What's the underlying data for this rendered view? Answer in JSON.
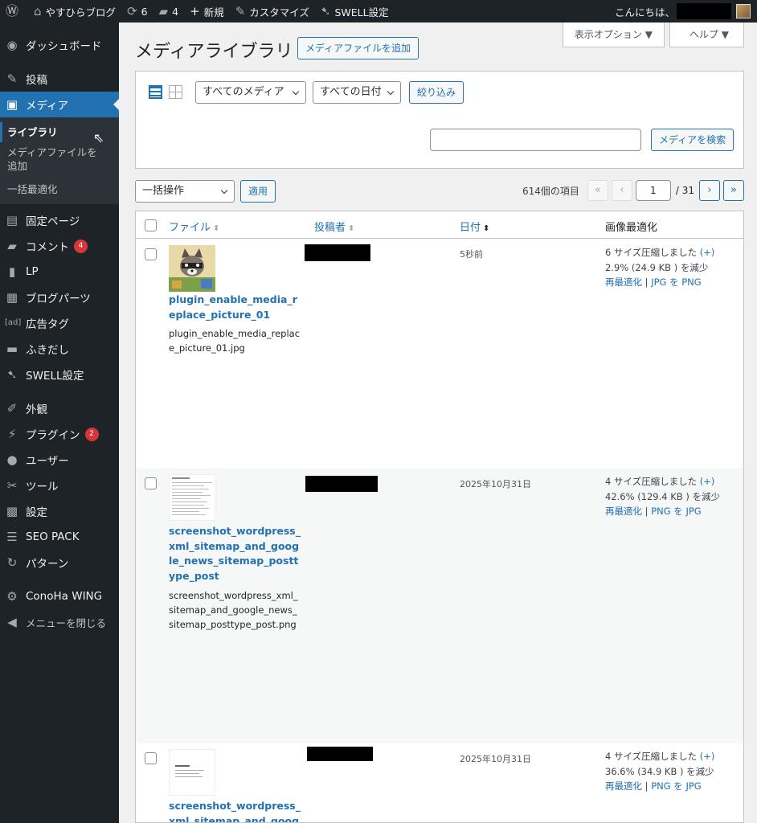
{
  "adminbar": {
    "site_name": "やすひらブログ",
    "updates_count": "6",
    "comments_count": "4",
    "new_label": "新規",
    "customize_label": "カスタマイズ",
    "swell_label": "SWELL設定",
    "greeting": "こんにちは、"
  },
  "sidebar": {
    "dashboard": "ダッシュボード",
    "posts": "投稿",
    "media": "メディア",
    "media_sub": [
      "ライブラリ",
      "メディアファイルを追加",
      "一括最適化"
    ],
    "pages": "固定ページ",
    "comments": "コメント",
    "comments_badge": "4",
    "lp": "LP",
    "blog_parts": "ブログパーツ",
    "ad_tag": "広告タグ",
    "ad_icon_text": "[ad]",
    "balloon": "ふきだし",
    "swell_settings": "SWELL設定",
    "appearance": "外観",
    "plugins": "プラグイン",
    "plugins_badge": "2",
    "users": "ユーザー",
    "tools": "ツール",
    "settings": "設定",
    "seo_pack": "SEO PACK",
    "patterns": "パターン",
    "conoha": "ConoHa WING",
    "collapse": "メニューを閉じる"
  },
  "screen_options": "表示オプション ▼",
  "help": "ヘルプ ▼",
  "page_title": "メディアライブラリ",
  "add_new": "メディアファイルを追加",
  "filters": {
    "media_type": "すべてのメディア",
    "date": "すべての日付",
    "filter_button": "絞り込み",
    "search_button": "メディアを検索"
  },
  "bulk": {
    "action": "一括操作",
    "apply": "適用"
  },
  "pagination": {
    "count": "614個の項目",
    "first": "«",
    "prev": "‹",
    "current_page": "1",
    "total": "/ 31",
    "next": "›",
    "last": "»"
  },
  "table": {
    "columns": [
      "ファイル",
      "投稿者",
      "日付",
      "画像最適化"
    ],
    "rows": [
      {
        "title": "plugin_enable_media_replace_picture_01",
        "filename": "plugin_enable_media_replace_picture_01.jpg",
        "date": "5秒前",
        "opt_line1": "6 サイズ圧縮しました",
        "opt_plus": "(+)",
        "opt_line2": "2.9% (24.9 KB ) を減少",
        "reoptimize": "再最適化",
        "convert": "JPG を PNG"
      },
      {
        "title": "screenshot_wordpress_xml_sitemap_and_google_news_sitemap_posttype_post",
        "filename": "screenshot_wordpress_xml_sitemap_and_google_news_sitemap_posttype_post.png",
        "date": "2025年10月31日",
        "opt_line1": "4 サイズ圧縮しました",
        "opt_plus": "(+)",
        "opt_line2": "42.6% (129.4 KB ) を減少",
        "reoptimize": "再最適化",
        "convert": "PNG を JPG"
      },
      {
        "title": "screenshot_wordpress_xml_sitemap_and_google_",
        "date": "2025年10月31日",
        "opt_line1": "4 サイズ圧縮しました",
        "opt_plus": "(+)",
        "opt_line2": "36.6% (34.9 KB ) を減少",
        "reoptimize": "再最適化",
        "convert": "PNG を JPG"
      }
    ]
  },
  "colors": {
    "admin_bar": "#1d2327",
    "accent": "#2271b1",
    "badge": "#d63638"
  }
}
